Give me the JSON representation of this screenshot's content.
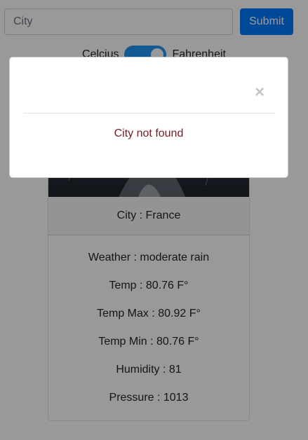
{
  "search": {
    "placeholder": "City",
    "value": "",
    "submit_label": "Submit"
  },
  "units": {
    "left_label": "Celcius",
    "right_label": "Fahrenheit",
    "selected": "Fahrenheit"
  },
  "card": {
    "city_line": "City : France",
    "lines": [
      "Weather : moderate rain",
      "Temp : 80.76 F°",
      "Temp Max : 80.92 F°",
      "Temp Min : 80.76 F°",
      "Humidity : 81",
      "Pressure : 1013"
    ]
  },
  "modal": {
    "close_glyph": "×",
    "message": "City not found"
  },
  "colors": {
    "primary": "#007bff",
    "toggle": "#2196f3",
    "error_text": "#721c24",
    "backdrop": "rgba(0,0,0,0.4)"
  }
}
